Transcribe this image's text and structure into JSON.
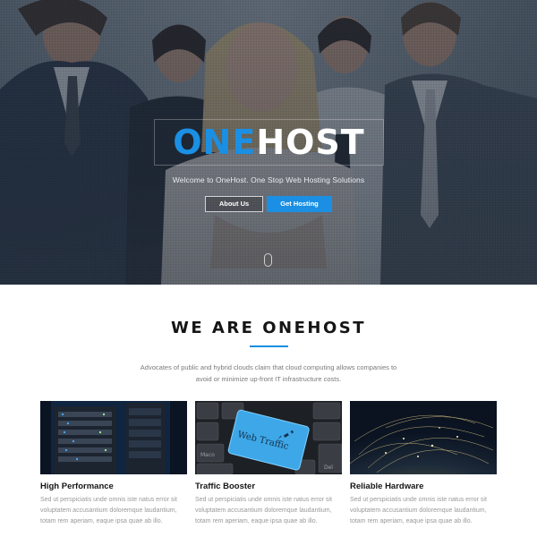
{
  "hero": {
    "logo_part1": "ONE",
    "logo_part2": "HOST",
    "tagline": "Welcome to OneHost. One Stop Web Hosting Solutions",
    "about_button": "About Us",
    "get_hosting_button": "Get Hosting"
  },
  "about": {
    "title": "WE ARE ONEHOST",
    "intro": "Advocates of public and hybrid clouds claim that cloud computing allows companies to avoid or minimize up-front IT infrastructure costs."
  },
  "features": [
    {
      "title": "High Performance",
      "text": "Sed ut perspiciatis unde omnis iste natus error sit voluptatem accusantium doloremque laudantium, totam rem aperiam, eaque ipsa quae ab illo."
    },
    {
      "title": "Traffic Booster",
      "text": "Sed ut perspiciatis unde omnis iste natus error sit voluptatem accusantium doloremque laudantium, totam rem aperiam, eaque ipsa quae ab illo.",
      "image_key_label": "Web Traffic",
      "image_key_labels": [
        "Del",
        "Maco"
      ]
    },
    {
      "title": "Reliable Hardware",
      "text": "Sed ut perspiciatis unde omnis iste natus error sit voluptatem accusantium doloremque laudantium, totam rem aperiam, eaque ipsa quae ab illo."
    }
  ],
  "colors": {
    "accent": "#1a8fe3",
    "heading": "#151515",
    "body_text": "#999999"
  },
  "icons": [
    "rocket-icon",
    "mouse-scroll-icon"
  ]
}
